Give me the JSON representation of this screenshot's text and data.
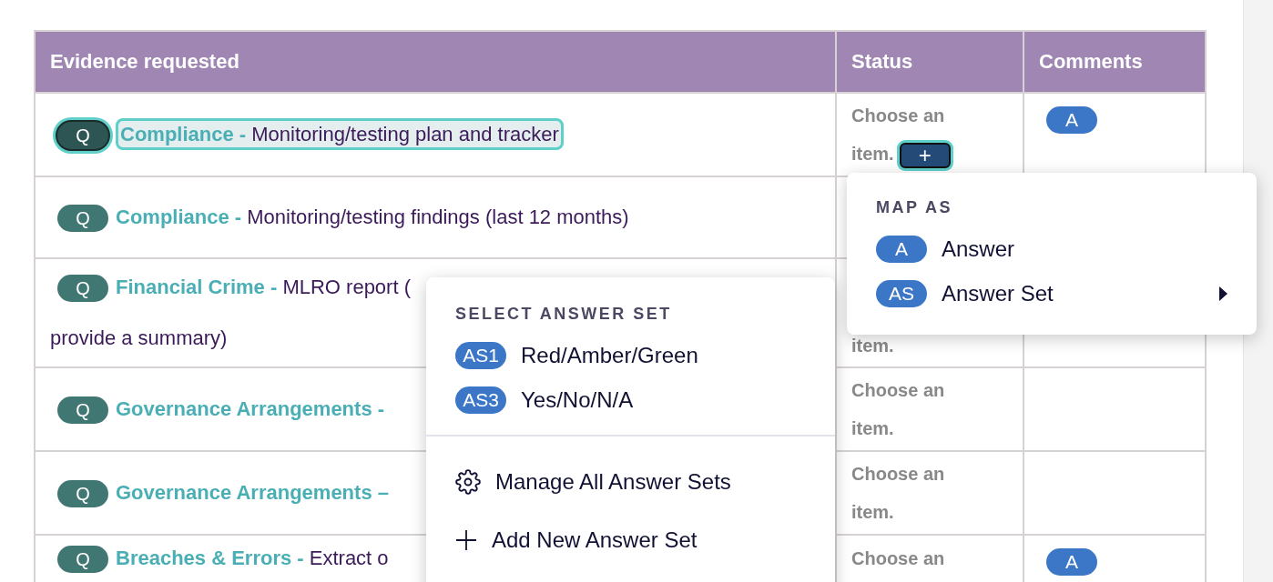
{
  "table": {
    "columns": [
      {
        "label": "Evidence requested"
      },
      {
        "label": "Status"
      },
      {
        "label": "Comments"
      }
    ],
    "rows": [
      {
        "badge": "Q",
        "focused": true,
        "category": "Compliance -",
        "description": "Monitoring/testing plan and tracker",
        "status": [
          "Choose an",
          "item."
        ],
        "add_button": "+",
        "comment": "A"
      },
      {
        "badge": "Q",
        "focused": false,
        "category": "Compliance -",
        "description": "Monitoring/testing findings (last 12 months)"
      },
      {
        "badge": "Q",
        "focused": false,
        "category": "Financial Crime -",
        "description": "MLRO report (",
        "continuation": "provide a summary)",
        "status": [
          "item."
        ]
      },
      {
        "badge": "Q",
        "focused": false,
        "category": "Governance Arrangements -",
        "status": [
          "Choose an",
          "item."
        ]
      },
      {
        "badge": "Q",
        "focused": false,
        "category": "Governance Arrangements –",
        "status": [
          "Choose an",
          "item."
        ]
      },
      {
        "badge": "Q",
        "focused": false,
        "category": "Breaches & Errors -",
        "description": "Extract o",
        "status": [
          "Choose an"
        ],
        "comment": "A"
      }
    ]
  },
  "map_menu": {
    "title": "MAP AS",
    "items": [
      {
        "badge": "A",
        "label": "Answer",
        "submenu": false
      },
      {
        "badge": "AS",
        "label": "Answer Set",
        "submenu": true
      }
    ]
  },
  "answer_set_menu": {
    "title": "SELECT ANSWER SET",
    "items": [
      {
        "badge": "AS1",
        "label": "Red/Amber/Green"
      },
      {
        "badge": "AS3",
        "label": "Yes/No/N/A"
      }
    ],
    "actions": [
      {
        "kind": "manage",
        "label": "Manage All Answer Sets"
      },
      {
        "kind": "add",
        "label": "Add New Answer Set"
      }
    ]
  }
}
